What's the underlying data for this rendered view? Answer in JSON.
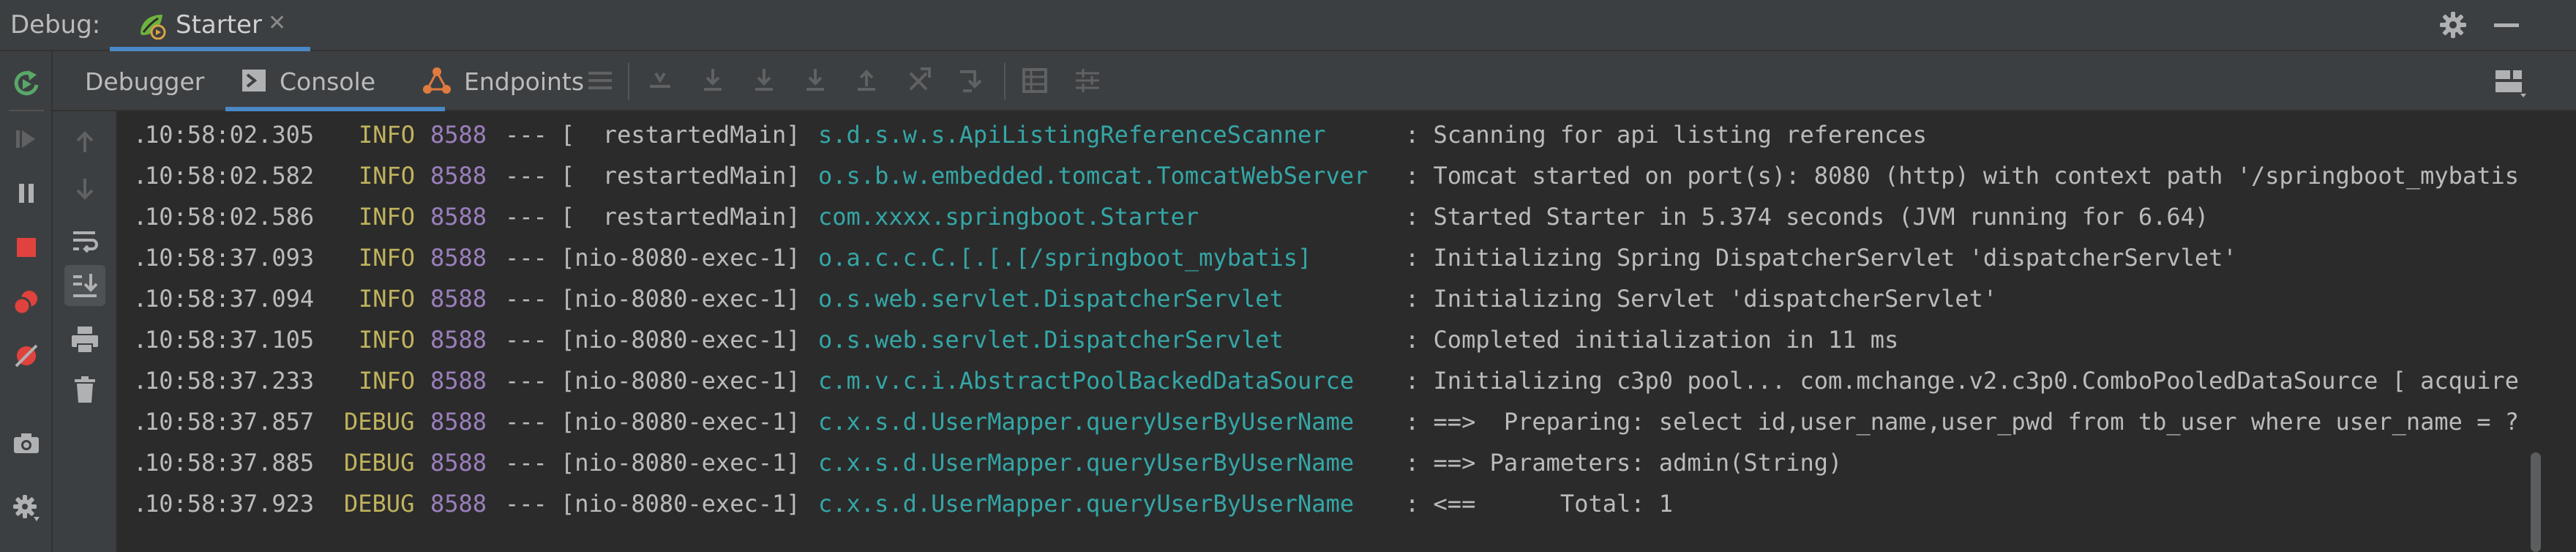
{
  "topbar": {
    "debug_label": "Debug:",
    "run_tab_label": "Starter",
    "close_glyph": "✕",
    "icons": {
      "tab": "spring-boot-run-icon",
      "settings": "gear-icon",
      "hide": "minimize-icon"
    }
  },
  "left_toolbar": {
    "icons": [
      "rerun-icon",
      "resume-icon",
      "pause-icon",
      "stop-icon",
      "view-breakpoints-icon",
      "mute-breakpoints-icon",
      "camera-icon",
      "settings-icon"
    ]
  },
  "tabs": {
    "debugger": "Debugger",
    "console": "Console",
    "endpoints": "Endpoints",
    "active": "Console"
  },
  "console_gutter": {
    "icons": [
      "up-arrow-icon",
      "down-arrow-icon",
      "soft-wrap-icon",
      "scroll-to-end-icon",
      "print-icon",
      "clear-all-icon"
    ]
  },
  "colors": {
    "background": "#2b2b2b",
    "panel": "#3c3f41",
    "accent": "#4a88c7",
    "level": "#c0b35d",
    "pid": "#9b7fbd",
    "logger": "#35a6a6"
  },
  "log_lines": [
    {
      "dot": ".",
      "time": "10:58:02.305",
      "level": "INFO",
      "pid": "8588",
      "sep": "---",
      "thread": "[  restartedMain]",
      "logger": "s.d.s.w.s.ApiListingReferenceScanner",
      "message": ": Scanning for api listing references"
    },
    {
      "dot": ".",
      "time": "10:58:02.582",
      "level": "INFO",
      "pid": "8588",
      "sep": "---",
      "thread": "[  restartedMain]",
      "logger": "o.s.b.w.embedded.tomcat.TomcatWebServer",
      "message": ": Tomcat started on port(s): 8080 (http) with context path '/springboot_mybatis"
    },
    {
      "dot": ".",
      "time": "10:58:02.586",
      "level": "INFO",
      "pid": "8588",
      "sep": "---",
      "thread": "[  restartedMain]",
      "logger": "com.xxxx.springboot.Starter",
      "message": ": Started Starter in 5.374 seconds (JVM running for 6.64)"
    },
    {
      "dot": ".",
      "time": "10:58:37.093",
      "level": "INFO",
      "pid": "8588",
      "sep": "---",
      "thread": "[nio-8080-exec-1]",
      "logger": "o.a.c.c.C.[.[.[/springboot_mybatis]",
      "message": ": Initializing Spring DispatcherServlet 'dispatcherServlet'"
    },
    {
      "dot": ".",
      "time": "10:58:37.094",
      "level": "INFO",
      "pid": "8588",
      "sep": "---",
      "thread": "[nio-8080-exec-1]",
      "logger": "o.s.web.servlet.DispatcherServlet",
      "message": ": Initializing Servlet 'dispatcherServlet'"
    },
    {
      "dot": ".",
      "time": "10:58:37.105",
      "level": "INFO",
      "pid": "8588",
      "sep": "---",
      "thread": "[nio-8080-exec-1]",
      "logger": "o.s.web.servlet.DispatcherServlet",
      "message": ": Completed initialization in 11 ms"
    },
    {
      "dot": ".",
      "time": "10:58:37.233",
      "level": "INFO",
      "pid": "8588",
      "sep": "---",
      "thread": "[nio-8080-exec-1]",
      "logger": "c.m.v.c.i.AbstractPoolBackedDataSource",
      "message": ": Initializing c3p0 pool... com.mchange.v2.c3p0.ComboPooledDataSource [ acquire"
    },
    {
      "dot": ".",
      "time": "10:58:37.857",
      "level": "DEBUG",
      "pid": "8588",
      "sep": "---",
      "thread": "[nio-8080-exec-1]",
      "logger": "c.x.s.d.UserMapper.queryUserByUserName",
      "message": ": ==>  Preparing: select id,user_name,user_pwd from tb_user where user_name = ?"
    },
    {
      "dot": ".",
      "time": "10:58:37.885",
      "level": "DEBUG",
      "pid": "8588",
      "sep": "---",
      "thread": "[nio-8080-exec-1]",
      "logger": "c.x.s.d.UserMapper.queryUserByUserName",
      "message": ": ==> Parameters: admin(String)"
    },
    {
      "dot": ".",
      "time": "10:58:37.923",
      "level": "DEBUG",
      "pid": "8588",
      "sep": "---",
      "thread": "[nio-8080-exec-1]",
      "logger": "c.x.s.d.UserMapper.queryUserByUserName",
      "message": ": <==      Total: 1"
    }
  ]
}
